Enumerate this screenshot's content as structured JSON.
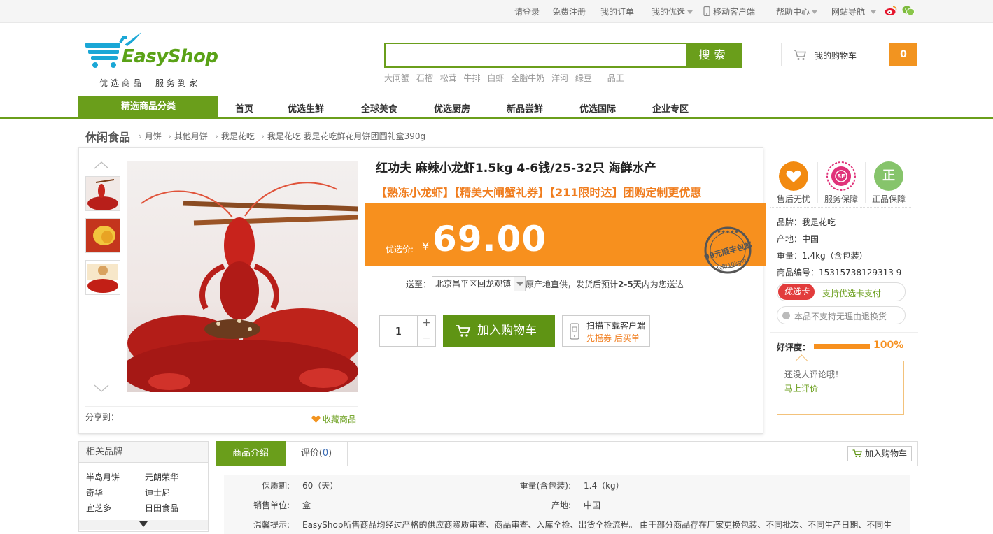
{
  "topbar": {
    "login": "请登录",
    "register": "免费注册",
    "orders": "我的订单",
    "my_youxuan": "我的优选",
    "mobile": "移动客户端",
    "help": "帮助中心",
    "site_nav": "网站导航"
  },
  "logo": {
    "brand": "EasyShop",
    "slogan": "优选商品　服务到家"
  },
  "search": {
    "value": "",
    "button": "搜索",
    "hot_words": [
      "大闸蟹",
      "石榴",
      "松茸",
      "牛排",
      "白虾",
      "全脂牛奶",
      "洋河",
      "绿豆",
      "一品王"
    ]
  },
  "cart": {
    "label": "我的购物车",
    "count": "0"
  },
  "nav": {
    "category": "精选商品分类",
    "items": [
      "首页",
      "优选生鲜",
      "全球美食",
      "优选厨房",
      "新品尝鲜",
      "优选国际",
      "企业专区"
    ]
  },
  "breadcrumb": {
    "root": "休闲食品",
    "items": [
      "月饼",
      "其他月饼",
      "我是花吃",
      "我是花吃  我是花吃鲜花月饼团圆礼盒390g"
    ]
  },
  "product": {
    "title": "红功夫 麻辣小龙虾1.5kg 4-6钱/25-32只 海鲜水产",
    "promo": "【熟冻小龙虾】【精美大闸蟹礼券】【211限时达】团购定制更优惠",
    "price_label": "优选价:",
    "currency": "¥",
    "price": "69.00",
    "stamp_text": "99元顺丰包邮",
    "stamp_sub": "仅限10kg内",
    "ship_label": "送至：",
    "ship_region": "北京昌平区回龙观镇",
    "ship_note_a": "原产地直供，发货后预计",
    "ship_note_days": "2-5天",
    "ship_note_b": "内为您送达",
    "qty": "1",
    "add_cart": "加入购物车",
    "scan_line1": "扫描下载客户端",
    "scan_line2": "先摇券 后买单",
    "share": "分享到：",
    "favorite": "收藏商品"
  },
  "side": {
    "badges": [
      {
        "label": "售后无忧",
        "color": "#f28a10"
      },
      {
        "label": "服务保障",
        "color": "#e0337a"
      },
      {
        "label": "正品保障",
        "color": "#86c46b",
        "glyph": "正"
      }
    ],
    "brand": "品牌：我是花吃",
    "origin": "产地：中国",
    "weight": "重量：1.4kg（含包装）",
    "sku": "商品编号：15315738129313 9",
    "youxuan_tag": "优选卡",
    "youxuan_text": "支持优选卡支付",
    "no_return": "本品不支持无理由退换货",
    "rating_label": "好评度：",
    "rating_pct": "100%",
    "rating_value": 100,
    "comment_empty": "还没人评论哦！",
    "comment_link": "马上评价"
  },
  "brands": {
    "title": "相关品牌",
    "items": [
      "半岛月饼",
      "元朗荣华",
      "奇华",
      "迪士尼",
      "宜芝多",
      "日田食品"
    ]
  },
  "tabs": {
    "intro": "商品介绍",
    "review": "评价(",
    "review_count": "0",
    "review_close": ")",
    "add_cart": "加入购物车"
  },
  "specs": {
    "shelf_k": "保质期:",
    "shelf_v": "60（天）",
    "weight_k": "重量(含包装):",
    "weight_v": "1.4（kg）",
    "unit_k": "销售单位:",
    "unit_v": "盒",
    "origin_k": "产地:",
    "origin_v": "中国",
    "tip_k": "温馨提示:",
    "tip_v": "EasyShop所售商品均经过严格的供应商资质审查、商品审查、入库全检、出货全检流程。 由于部分商品存在厂家更换包装、不同批次、不同生产日期、不同生"
  }
}
